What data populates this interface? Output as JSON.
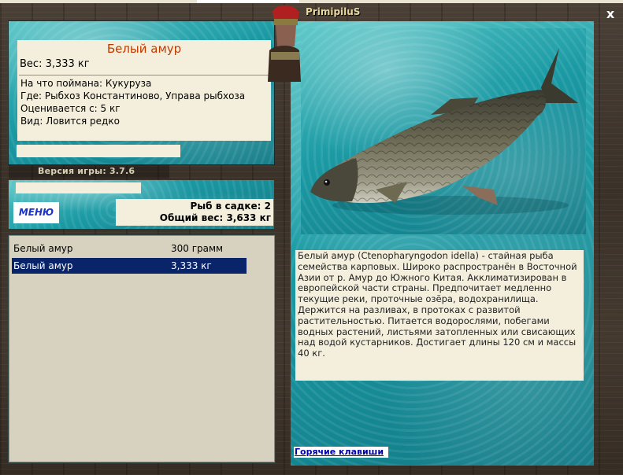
{
  "player": {
    "name": "PrimipiluS"
  },
  "fish_card": {
    "title": "Белый амур",
    "weight_line": "Вес: 3,333 кг",
    "bait_line": "На что поймана: Кукуруза",
    "place_line": "Где: Рыбхоз Константиново, Управа рыбхоза",
    "value_line": "Оценивается с: 5 кг",
    "rarity_line": "Вид: Ловится редко"
  },
  "version": "Версия игры: 3.7.6",
  "menu": {
    "label": "МЕНЮ"
  },
  "stats": {
    "fish_in_keepnet": "Рыб в садке: 2",
    "total_weight": "Общий вес: 3,633 кг"
  },
  "catch_list": [
    {
      "name": "Белый амур",
      "weight": "300 грамм",
      "selected": false
    },
    {
      "name": "Белый амур",
      "weight": "3,333 кг",
      "selected": true
    }
  ],
  "description": "Белый амур (Ctenopharyngodon idella) - стайная рыба семейства карповых. Широко распространён в Восточной Азии от р. Амур до Южного Китая. Акклиматизирован в европейской части страны. Предпочитает медленно текущие реки, проточные озёра, водохранилища. Держится на разливах, в протоках с развитой растительностью. Питается водорослями, побегами водных растений, листьями затопленных или свисающих над водой кустарников. Достигает длины 120 см и массы 40 кг.",
  "hotkeys": {
    "label": "Горячие клавиши"
  },
  "close": {
    "label": "x"
  },
  "colors": {
    "title": "#c03a00",
    "selection": "#0a246a",
    "menu_text": "#1a30c8",
    "link": "#0000aa"
  }
}
